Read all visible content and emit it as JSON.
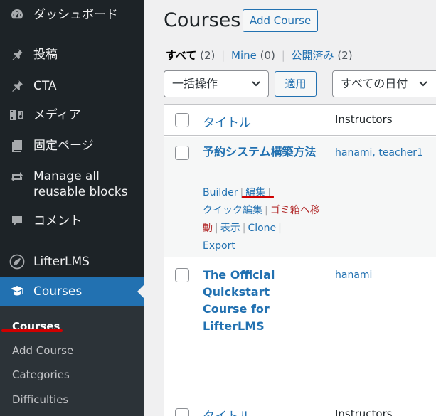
{
  "sidebar": {
    "items": [
      {
        "label": "ダッシュボード",
        "icon": "dashboard-icon"
      },
      {
        "label": "投稿",
        "icon": "pin-icon"
      },
      {
        "label": "CTA",
        "icon": "pin-icon"
      },
      {
        "label": "メディア",
        "icon": "media-icon"
      },
      {
        "label": "固定ページ",
        "icon": "page-icon"
      },
      {
        "label": "Manage all reusable blocks",
        "icon": "reusable-blocks-icon"
      },
      {
        "label": "コメント",
        "icon": "comment-icon"
      },
      {
        "label": "LifterLMS",
        "icon": "rocket-icon"
      },
      {
        "label": "Courses",
        "icon": "graduation-cap-icon"
      }
    ],
    "submenu": [
      "Courses",
      "Add Course",
      "Categories",
      "Difficulties"
    ]
  },
  "header": {
    "title": "Courses",
    "add_button": "Add Course"
  },
  "filters": {
    "all": "すべて",
    "all_count": "(2)",
    "mine": "Mine",
    "mine_count": "(0)",
    "published": "公開済み",
    "published_count": "(2)",
    "sep": "|"
  },
  "toolbar": {
    "bulk_action": "一括操作",
    "apply": "適用",
    "dates": "すべての日付"
  },
  "table": {
    "col_title": "タイトル",
    "col_instructors": "Instructors",
    "rows": [
      {
        "title": "予約システム構築方法",
        "instructors": "hanami, teacher1",
        "actions": {
          "builder": "Builder",
          "edit": "編集",
          "quick_edit": "クイック編集",
          "trash": "ゴミ箱へ移動",
          "view": "表示",
          "clone": "Clone",
          "export": "Export"
        }
      },
      {
        "title": "The Official Quickstart Course for LifterLMS",
        "instructors": "hanami"
      }
    ]
  },
  "colors": {
    "accent": "#2271b1",
    "sidebar_bg": "#1d2327",
    "annotation_red": "#d00000",
    "delete_red": "#b32d2e"
  }
}
